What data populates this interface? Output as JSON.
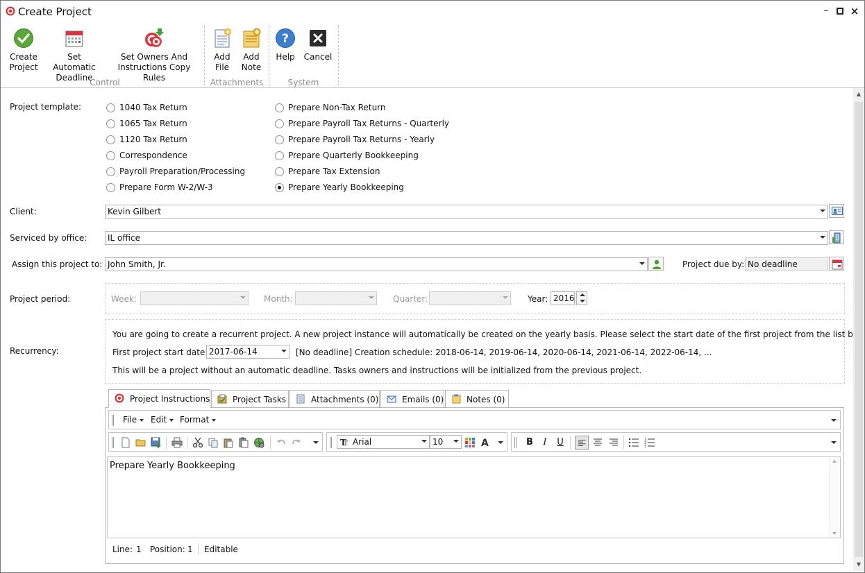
{
  "window": {
    "title": "Create Project"
  },
  "ribbon": {
    "buttons": [
      {
        "label1": "Create",
        "label2": "Project",
        "icon": "checkmark-icon"
      },
      {
        "label1": "Set Automatic",
        "label2": "Deadline",
        "icon": "calendar-icon"
      },
      {
        "label1": "Set Owners And",
        "label2": "Instructions Copy Rules",
        "icon": "target-icon"
      },
      {
        "label1": "Add",
        "label2": "File",
        "icon": "add-file-icon"
      },
      {
        "label1": "Add",
        "label2": "Note",
        "icon": "add-note-icon"
      },
      {
        "label1": "Help",
        "label2": "",
        "icon": "help-icon"
      },
      {
        "label1": "Cancel",
        "label2": "",
        "icon": "close-icon"
      }
    ],
    "groups": [
      "Control",
      "Attachments",
      "System"
    ]
  },
  "form": {
    "template_label": "Project template:",
    "templates_col1": [
      "1040 Tax Return",
      "1065 Tax Return",
      "1120 Tax Return",
      "Correspondence",
      "Payroll Preparation/Processing",
      "Prepare Form W-2/W-3"
    ],
    "templates_col2": [
      "Prepare Non-Tax Return",
      "Prepare Payroll Tax Returns - Quarterly",
      "Prepare Payroll Tax Returns - Yearly",
      "Prepare Quarterly Bookkeeping",
      "Prepare Tax Extension",
      "Prepare Yearly Bookkeeping"
    ],
    "selected_template": "Prepare Yearly Bookkeeping",
    "client_label": "Client:",
    "client_value": "Kevin Gilbert",
    "office_label": "Serviced by office:",
    "office_value": "IL office",
    "assign_label": "Assign this project to:",
    "assign_value": "John Smith, Jr.",
    "due_label": "Project due by:",
    "due_value": "No deadline",
    "period_label": "Project period:",
    "week_label": "Week:",
    "month_label": "Month:",
    "quarter_label": "Quarter:",
    "year_label": "Year:",
    "year_value": "2016",
    "recurrency_label": "Recurrency:",
    "recurrency_line1": "You are going to create a recurrent project. A new project instance will automatically be created on the yearly basis. Please select the start date of the first project from the list below.",
    "first_start_label": "First project start date:",
    "first_start_value": "2017-06-14",
    "schedule_text": "[No deadline]  Creation schedule: 2018-06-14, 2019-06-14, 2020-06-14, 2021-06-14, 2022-06-14, ...",
    "recurrency_line3": "This will be a project without an automatic deadline. Tasks owners and instructions will be initialized from the previous project."
  },
  "tabs": [
    {
      "label": "Project Instructions",
      "icon": "target-icon"
    },
    {
      "label": "Project Tasks",
      "icon": "tasks-icon"
    },
    {
      "label": "Attachments (0)",
      "icon": "attachments-icon"
    },
    {
      "label": "Emails (0)",
      "icon": "email-icon"
    },
    {
      "label": "Notes (0)",
      "icon": "notes-icon"
    }
  ],
  "editor": {
    "menu": [
      "File",
      "Edit",
      "Format"
    ],
    "font": "Arial",
    "size": "10",
    "text": "Prepare Yearly Bookkeeping"
  },
  "status": {
    "line_label": "Line:",
    "line_value": "1",
    "pos_label": "Position:",
    "pos_value": "1",
    "mode": "Editable"
  },
  "colors": {
    "accent": "#3c7fd1",
    "checkmark": "#5aa73a",
    "target": "#d8343a"
  }
}
